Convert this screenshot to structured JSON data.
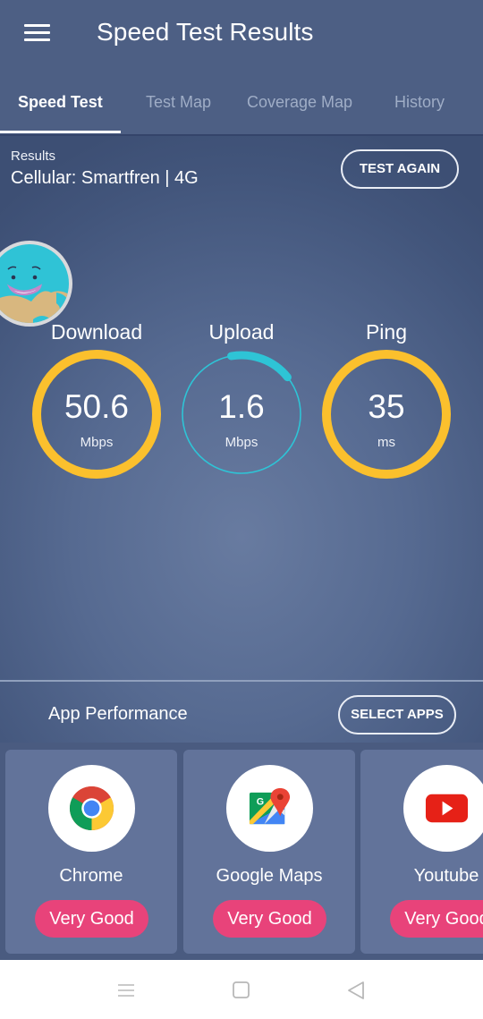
{
  "header": {
    "title": "Speed Test Results",
    "menu_icon": "hamburger-menu-icon"
  },
  "tabs": [
    {
      "label": "Speed Test",
      "active": true
    },
    {
      "label": "Test Map",
      "active": false
    },
    {
      "label": "Coverage Map",
      "active": false
    },
    {
      "label": "History",
      "active": false
    }
  ],
  "results": {
    "label": "Results",
    "network": "Cellular: Smartfren | 4G",
    "test_again_label": "TEST AGAIN"
  },
  "mascot": {
    "icon": "smiling-globe-mascot-icon"
  },
  "gauges": [
    {
      "title": "Download",
      "value": "50.6",
      "unit": "Mbps",
      "color": "#fbc02d",
      "fill_fraction": 1.0
    },
    {
      "title": "Upload",
      "value": "1.6",
      "unit": "Mbps",
      "color": "#2ec4d6",
      "fill_fraction": 0.17
    },
    {
      "title": "Ping",
      "value": "35",
      "unit": "ms",
      "color": "#fbc02d",
      "fill_fraction": 1.0
    }
  ],
  "app_performance": {
    "title": "App Performance",
    "select_apps_label": "SELECT APPS",
    "apps": [
      {
        "name": "Chrome",
        "rating": "Very Good",
        "icon": "chrome-icon"
      },
      {
        "name": "Google Maps",
        "rating": "Very Good",
        "icon": "google-maps-icon"
      },
      {
        "name": "Youtube",
        "rating": "Very Good",
        "icon": "youtube-icon"
      }
    ]
  },
  "colors": {
    "header_bg": "#4d5f84",
    "accent_yellow": "#fbc02d",
    "accent_teal": "#2ec4d6",
    "badge_pink": "#e8437a",
    "card_bg": "#62739a"
  },
  "navbar": {
    "items": [
      "recent-apps-icon",
      "home-icon",
      "back-icon"
    ]
  }
}
